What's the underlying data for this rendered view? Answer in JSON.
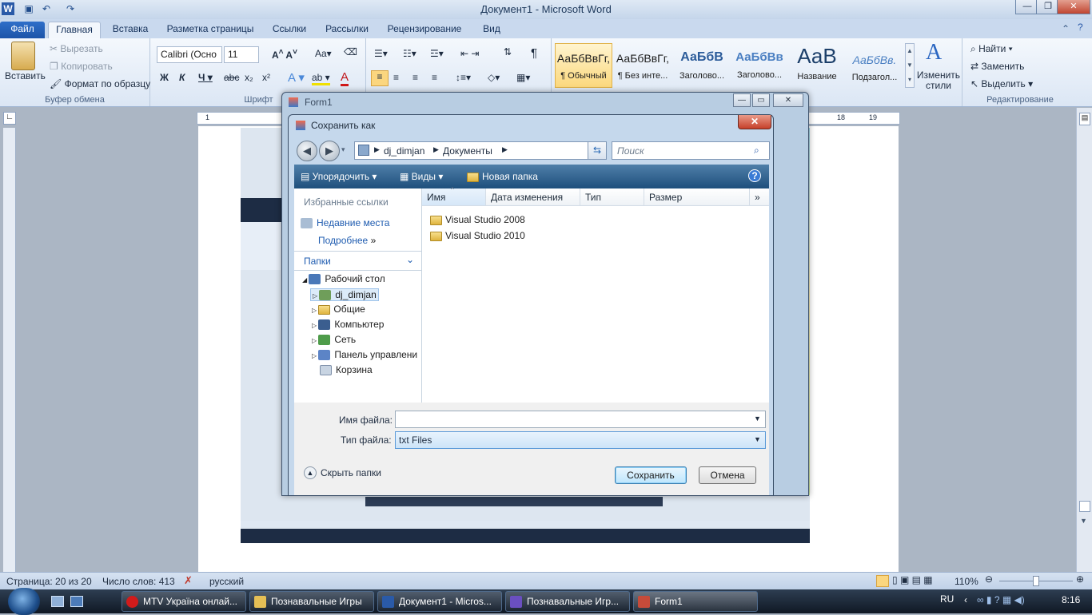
{
  "word": {
    "title": "Документ1 - Microsoft Word",
    "tabs": [
      "Файл",
      "Главная",
      "Вставка",
      "Разметка страницы",
      "Ссылки",
      "Рассылки",
      "Рецензирование",
      "Вид"
    ],
    "clipboard": {
      "paste": "Вставить",
      "cut": "Вырезать",
      "copy": "Копировать",
      "format": "Формат по образцу",
      "label": "Буфер обмена"
    },
    "font": {
      "name": "Calibri (Осно",
      "size": "11",
      "label": "Шрифт"
    },
    "styles": [
      {
        "sample": "АаБбВвГг,",
        "name": "¶ Обычный"
      },
      {
        "sample": "АаБбВвГг,",
        "name": "¶ Без инте..."
      },
      {
        "sample": "АаБбВ",
        "name": "Заголово..."
      },
      {
        "sample": "АаБбВв",
        "name": "Заголово..."
      },
      {
        "sample": "АаВ",
        "name": "Название"
      },
      {
        "sample": "АаБбВв.",
        "name": "Подзагол..."
      }
    ],
    "change_styles": "Изменить стили",
    "editing": {
      "find": "Найти",
      "replace": "Заменить",
      "select": "Выделить",
      "label": "Редактирование"
    },
    "ruler_marks": [
      "1",
      "18",
      "19"
    ],
    "status": {
      "page": "Страница: 20 из 20",
      "words": "Число слов: 413",
      "lang": "русский",
      "zoom": "110%"
    }
  },
  "form1": {
    "title": "Form1"
  },
  "dialog": {
    "title": "Сохранить как",
    "path": [
      "dj_dimjan",
      "Документы"
    ],
    "search_placeholder": "Поиск",
    "toolbar": {
      "organize": "Упорядочить",
      "views": "Виды",
      "new_folder": "Новая папка"
    },
    "favorites_header": "Избранные ссылки",
    "favorites": [
      "Недавние места",
      "Подробнее"
    ],
    "folders_header": "Папки",
    "tree_root": "Рабочий стол",
    "tree": [
      "dj_dimjan",
      "Общие",
      "Компьютер",
      "Сеть",
      "Панель управлени",
      "Корзина"
    ],
    "columns": [
      "Имя",
      "Дата изменения",
      "Тип",
      "Размер"
    ],
    "files": [
      "Visual Studio 2008",
      "Visual Studio 2010"
    ],
    "filename_label": "Имя файла:",
    "filename_value": "",
    "filetype_label": "Тип файла:",
    "filetype_value": "txt Files",
    "hide_folders": "Скрыть папки",
    "save": "Сохранить",
    "cancel": "Отмена"
  },
  "taskbar": {
    "items": [
      "MTV Україна онлай...",
      "Познавальные Игры",
      "Документ1 - Micros...",
      "Познавальные Игр...",
      "Form1"
    ],
    "lang": "RU",
    "time": "8:16"
  },
  "colors": {
    "accent": "#1c54a8",
    "selection": "#cfe3f7",
    "taskbar": "#0f1824"
  }
}
